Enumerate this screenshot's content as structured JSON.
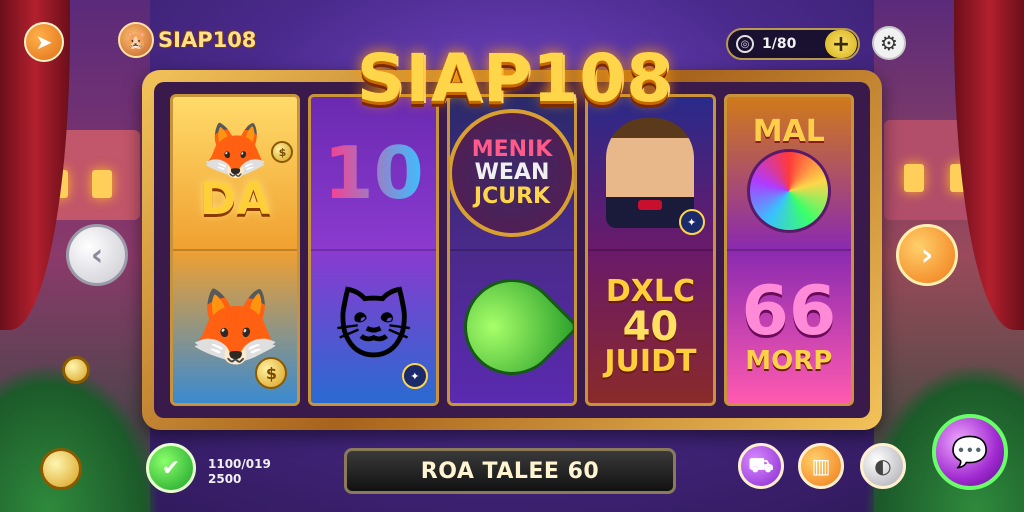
{
  "header": {
    "brand_name": "SIAP108",
    "balance": "1/80",
    "plus_label": "+"
  },
  "title": "SIAP108",
  "reels": [
    {
      "top": "DA",
      "bottom_icon": "fox-mask-icon"
    },
    {
      "top": "10",
      "bottom_icon": "cat-icon"
    },
    {
      "top_lines": [
        "MENIK",
        "WEAN",
        "JCURK"
      ],
      "bottom_icon": "green-leaf-icon"
    },
    {
      "top_icon": "man-avatar",
      "bottom_lines": [
        "DXLC",
        "40",
        "JUIDT"
      ]
    },
    {
      "top": "MAL",
      "middle_icon": "swirl-icon",
      "bottom_num": "66",
      "bottom": "MORP"
    }
  ],
  "bottom": {
    "bet_line1": "1100/019",
    "bet_line2": "2500",
    "action_label": "ROA TALEE 60"
  },
  "colors": {
    "gold": "#ffd64a",
    "frame": "#c8943a",
    "spin_green": "#1aa02a",
    "nav_orange": "#f07a1a"
  }
}
